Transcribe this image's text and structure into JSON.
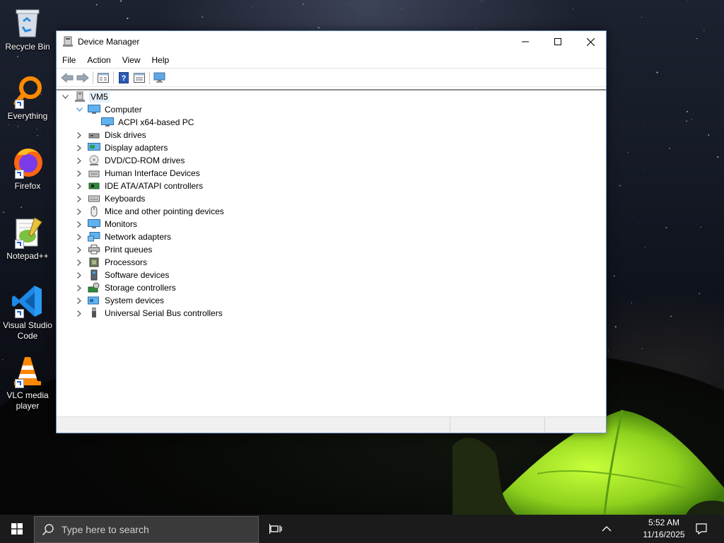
{
  "desktop": {
    "icons": [
      {
        "label": "Recycle Bin",
        "icon": "recycle-bin-icon"
      },
      {
        "label": "Everything",
        "icon": "everything-search-icon"
      },
      {
        "label": "Firefox",
        "icon": "firefox-icon"
      },
      {
        "label": "Notepad++",
        "icon": "notepad-plus-plus-icon"
      },
      {
        "label": "Visual Studio Code",
        "icon": "vscode-icon"
      },
      {
        "label": "VLC media player",
        "icon": "vlc-icon"
      }
    ]
  },
  "window": {
    "title": "Device Manager",
    "controls": {
      "minimize": "minimize-icon",
      "maximize": "maximize-icon",
      "close": "close-icon"
    },
    "menu": [
      "File",
      "Action",
      "View",
      "Help"
    ],
    "toolbar": [
      "back-arrow-icon",
      "forward-arrow-icon",
      "properties-icon",
      "help-icon",
      "show-hide-icon",
      "monitor-scan-icon"
    ]
  },
  "tree": {
    "root": "VM5",
    "computer": {
      "label": "Computer",
      "expanded": true,
      "children": [
        "ACPI x64-based PC"
      ]
    },
    "categories": [
      {
        "label": "Disk drives",
        "icon": "disk-drive-icon"
      },
      {
        "label": "Display adapters",
        "icon": "display-adapter-icon"
      },
      {
        "label": "DVD/CD-ROM drives",
        "icon": "dvd-drive-icon"
      },
      {
        "label": "Human Interface Devices",
        "icon": "hid-icon"
      },
      {
        "label": "IDE ATA/ATAPI controllers",
        "icon": "ide-controller-icon"
      },
      {
        "label": "Keyboards",
        "icon": "keyboard-icon"
      },
      {
        "label": "Mice and other pointing devices",
        "icon": "mouse-icon"
      },
      {
        "label": "Monitors",
        "icon": "monitor-icon"
      },
      {
        "label": "Network adapters",
        "icon": "network-adapter-icon"
      },
      {
        "label": "Print queues",
        "icon": "printer-icon"
      },
      {
        "label": "Processors",
        "icon": "processor-icon"
      },
      {
        "label": "Software devices",
        "icon": "software-device-icon"
      },
      {
        "label": "Storage controllers",
        "icon": "storage-controller-icon"
      },
      {
        "label": "System devices",
        "icon": "system-device-icon"
      },
      {
        "label": "Universal Serial Bus controllers",
        "icon": "usb-icon"
      }
    ]
  },
  "taskbar": {
    "search_placeholder": "Type here to search",
    "time": "5:52 AM",
    "date": "11/16/2025"
  },
  "colors": {
    "accent": "#0078d7",
    "selection": "#e5f0fb",
    "taskbar": "#1b1b1b"
  }
}
